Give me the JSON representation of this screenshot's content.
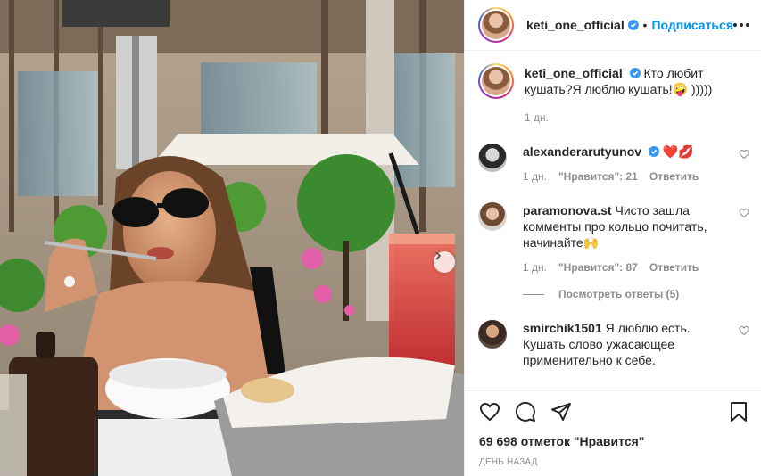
{
  "author": {
    "username": "keti_one_official",
    "follow_label": "Подписаться",
    "dot": "•"
  },
  "caption": {
    "username": "keti_one_official",
    "text": " Кто любит кушать?Я люблю кушать!🤪 )))))",
    "time": "1 дн."
  },
  "comments": [
    {
      "username": "alexanderarutyunov",
      "text": " ❤️💋",
      "time": "1 дн.",
      "likes": "\"Нравится\": 21",
      "reply": "Ответить"
    },
    {
      "username": "paramonova.st",
      "text": " Чисто зашла комменты про кольцо почитать, начинайте🙌",
      "time": "1 дн.",
      "likes": "\"Нравится\": 87",
      "reply": "Ответить",
      "view_replies": "Посмотреть ответы (5)"
    },
    {
      "username": "smirchik1501",
      "text": " Я люблю есть. Кушать слово ужасающее применительно к себе."
    }
  ],
  "likes_count": "69 698 отметок \"Нравится\"",
  "date": "ДЕНЬ НАЗАД",
  "icons": {
    "heart": "heart-icon",
    "comment": "comment-icon",
    "share": "share-icon",
    "save": "bookmark-icon",
    "verified": "verified-badge-icon",
    "more": "more-options-icon",
    "next": "chevron-right-icon"
  },
  "colors": {
    "accent": "#0095f6",
    "verified": "#3897f0",
    "muted": "#8e8e8e"
  }
}
